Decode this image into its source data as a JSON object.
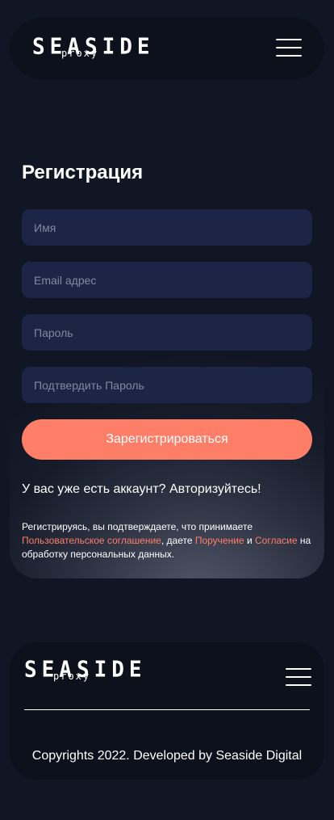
{
  "header": {
    "logo_main": "SEASIDE",
    "logo_sub": "proxy",
    "menu_icon": "hamburger-menu-icon"
  },
  "register": {
    "title": "Регистрация",
    "name_placeholder": "Имя",
    "email_placeholder": "Email адрес",
    "password_placeholder": "Пароль",
    "confirm_placeholder": "Подтвердить Пароль",
    "submit_label": "Зарегистрироваться",
    "have_account_text": "У вас уже есть аккаунт?",
    "login_link": "Авторизуйтесь!",
    "legal": {
      "prefix": "Регистрируясь, вы подтверждаете, что принимаете",
      "agreement_link": "Пользовательское соглашение",
      "middle": ", даете",
      "assignment_link": "Поручение",
      "and": "и",
      "consent_link": "Согласие",
      "suffix": "на обработку персональных данных."
    }
  },
  "footer": {
    "logo_main": "SEASIDE",
    "logo_sub": "proxy",
    "copyright": "Copyrights 2022. Developed by Seaside Digital"
  },
  "colors": {
    "background": "#111624",
    "panel": "#0d111c",
    "input_bg": "#1d2546",
    "accent": "#ff7e67",
    "text": "#ffffff",
    "placeholder": "#8088a3"
  }
}
